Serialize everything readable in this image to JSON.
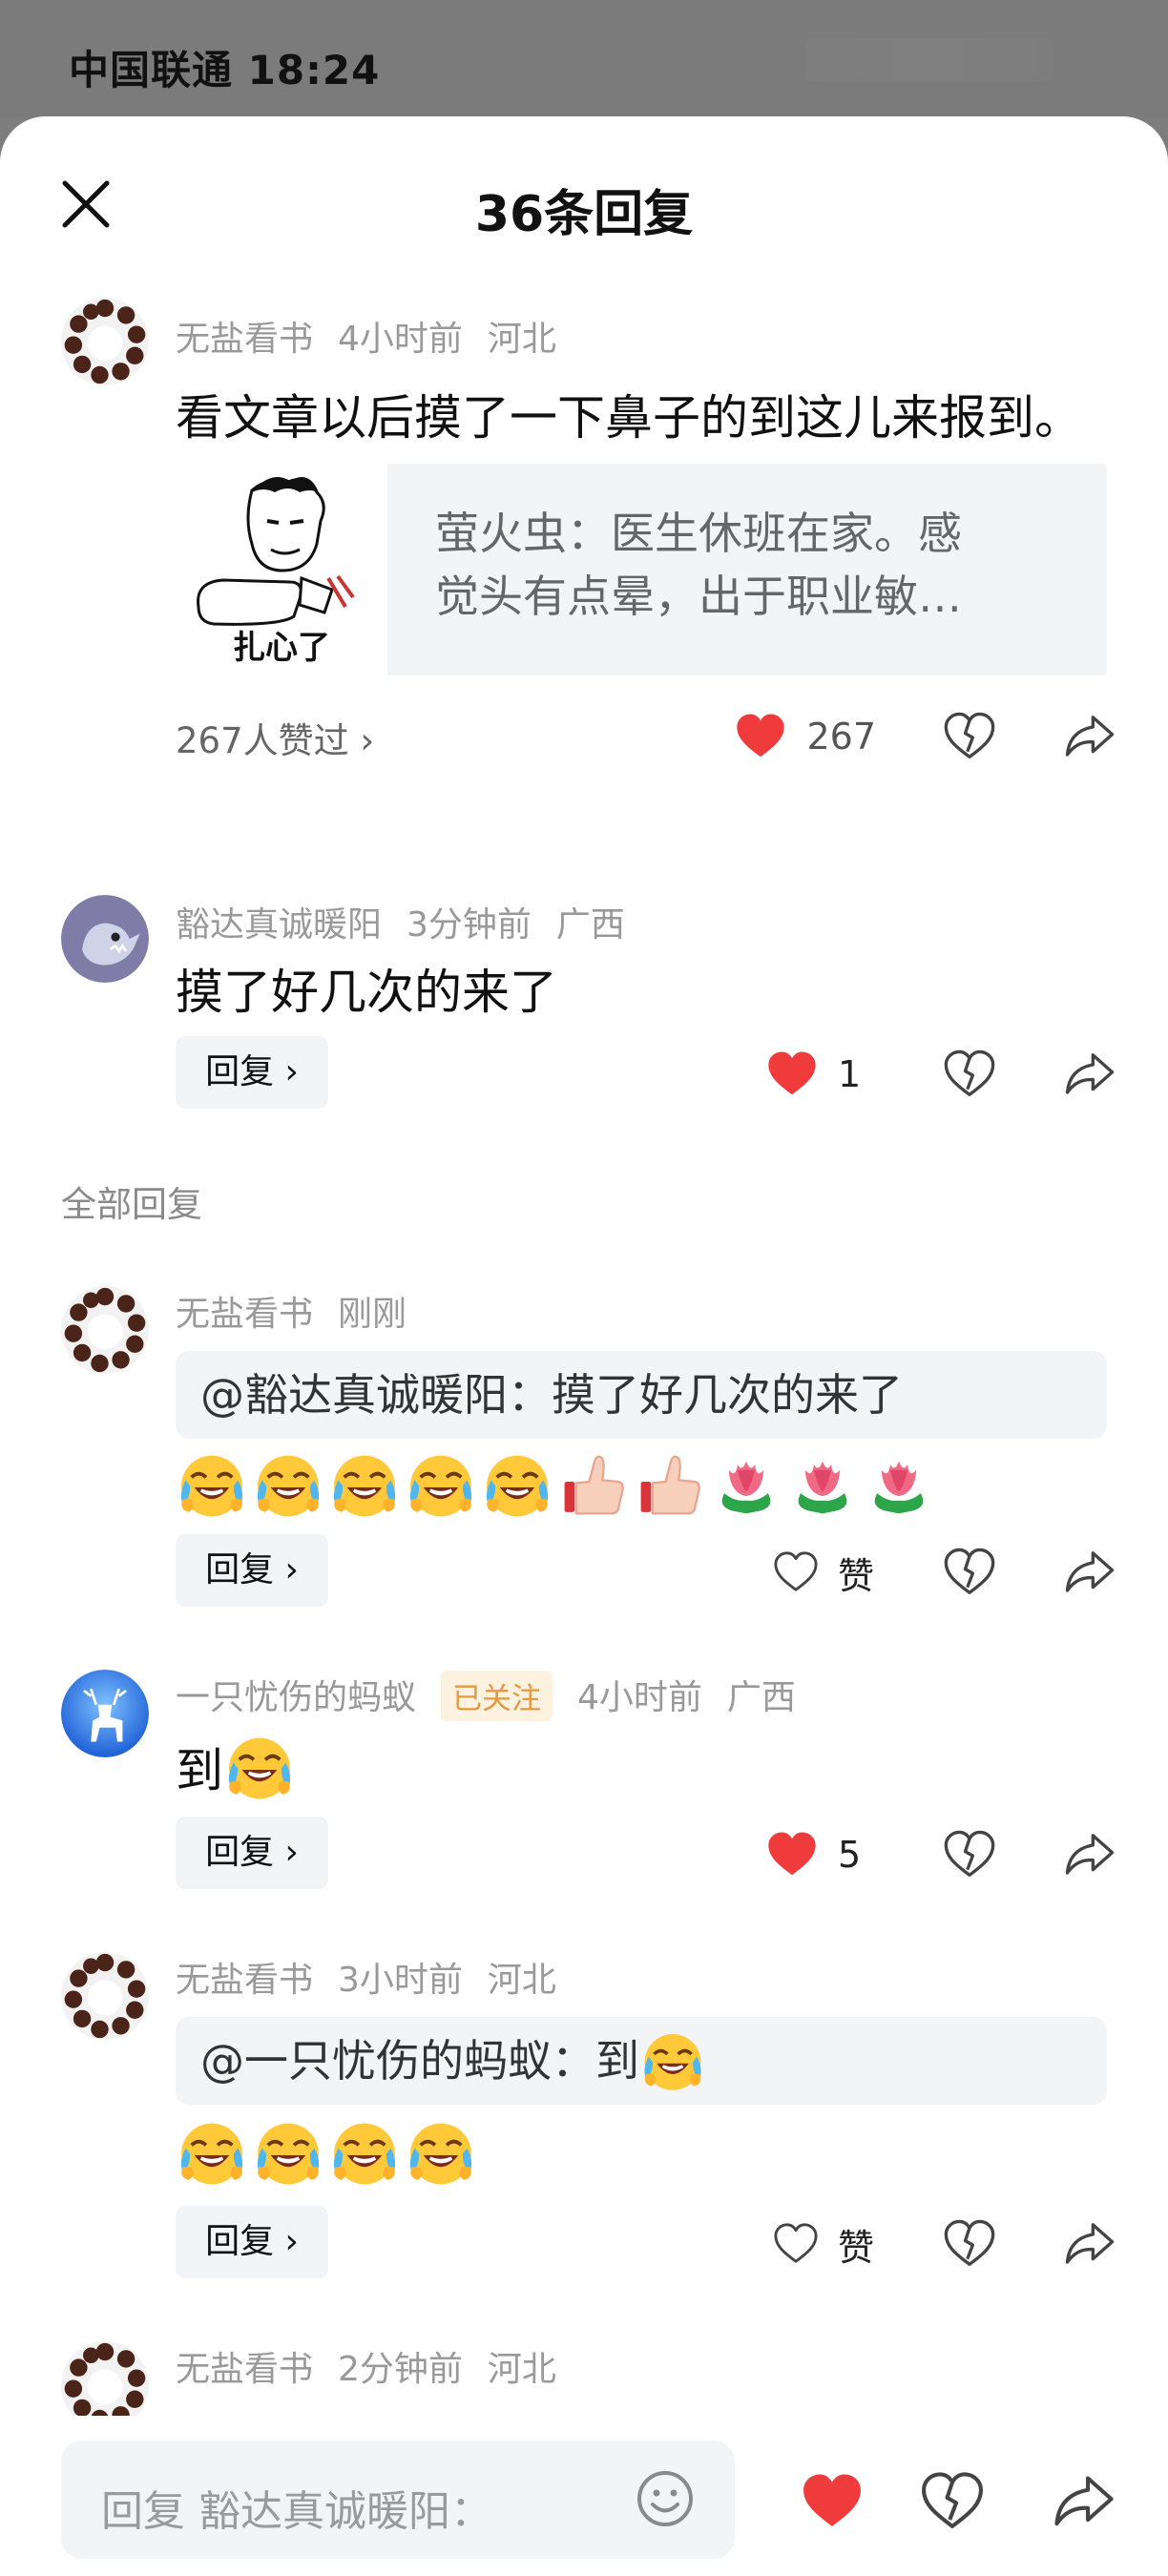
{
  "status": {
    "carrier": "中国联通 18:24"
  },
  "sheet": {
    "title": "36条回复"
  },
  "top_comment": {
    "user": "无盐看书",
    "time": "4小时前",
    "region": "河北",
    "text": "看文章以后摸了一下鼻子的到这儿来报到。",
    "card": {
      "thumb_caption": "扎心了",
      "text_line1": "萤火虫：医生休班在家。感",
      "text_line2": "觉头有点晕，出于职业敏…"
    },
    "likes_line": "267人赞过 ›",
    "like_count": "267"
  },
  "first_reply": {
    "user": "豁达真诚暖阳",
    "time": "3分钟前",
    "region": "广西",
    "text": "摸了好几次的来了",
    "reply_label": "回复 ›",
    "like_count": "1"
  },
  "section_label": "全部回复",
  "replies": [
    {
      "user": "无盐看书",
      "time": "刚刚",
      "quote": "@豁达真诚暖阳：摸了好几次的来了",
      "emojis": [
        "laugh-cry",
        "laugh-cry",
        "laugh-cry",
        "laugh-cry",
        "laugh-cry",
        "thumbs-up",
        "thumbs-up",
        "tulip",
        "tulip",
        "tulip"
      ],
      "reply_label": "回复 ›",
      "like_label": "赞"
    },
    {
      "user": "一只忧伤的蚂蚁",
      "badge": "已关注",
      "time": "4小时前",
      "region": "广西",
      "text": "到",
      "reply_label": "回复 ›",
      "like_count": "5"
    },
    {
      "user": "无盐看书",
      "time": "3小时前",
      "region": "河北",
      "quote": "@一只忧伤的蚂蚁：到",
      "reply_label": "回复 ›",
      "like_label": "赞"
    },
    {
      "user": "无盐看书",
      "time": "2分钟前",
      "region": "河北"
    }
  ],
  "bottom": {
    "input_placeholder": "回复 豁达真诚暖阳："
  },
  "colors": {
    "like_red": "#ef3b3b",
    "muted": "#999999",
    "chip_bg": "#f3f4f6"
  }
}
